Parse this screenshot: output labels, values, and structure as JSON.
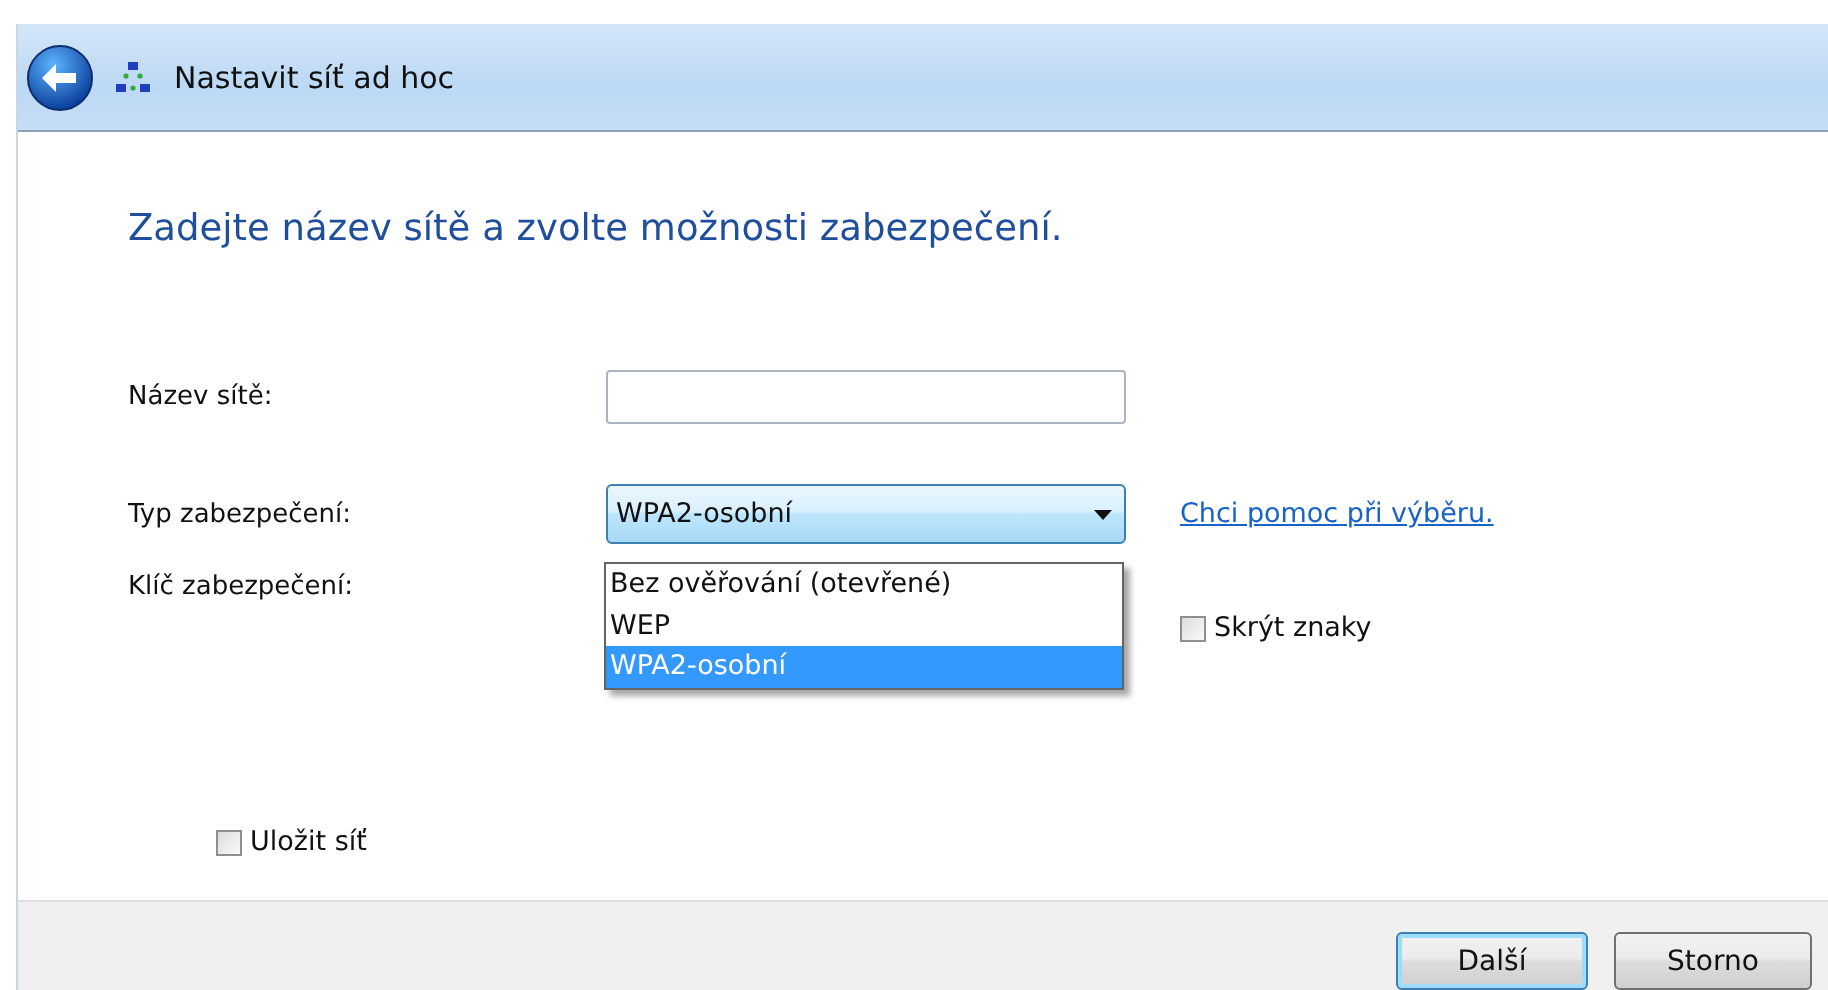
{
  "window": {
    "title": "Nastavit síť ad hoc"
  },
  "heading": "Zadejte název sítě a zvolte možnosti zabezpečení.",
  "network_name": {
    "label": "Název sítě:"
  },
  "security_type": {
    "label": "Typ zabezpečení:",
    "value": "WPA2-osobní",
    "expanded": true,
    "options": [
      {
        "label": "Bez ověřování (otevřené)",
        "selected": false
      },
      {
        "label": "WEP",
        "selected": false
      },
      {
        "label": "WPA2-osobní",
        "selected": true
      }
    ]
  },
  "help_link": "Chci pomoc při výběru.",
  "security_key": {
    "label": "Klíč zabezpečení:"
  },
  "hide_characters": {
    "label": "Skrýt znaky",
    "checked": false
  },
  "save_network": {
    "label": "Uložit síť",
    "checked": false
  },
  "buttons": [
    {
      "label": "Další",
      "default": true
    },
    {
      "label": "Storno",
      "default": false
    }
  ]
}
